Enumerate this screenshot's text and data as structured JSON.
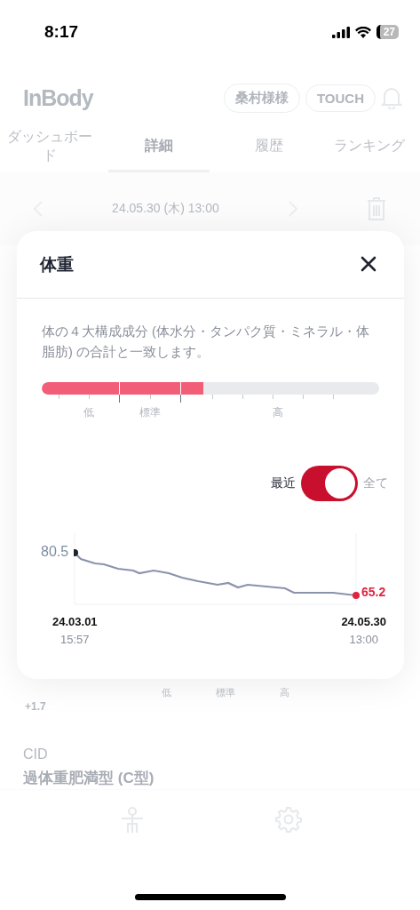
{
  "status_bar": {
    "time": "8:17",
    "battery": "27"
  },
  "header": {
    "logo": "InBody",
    "user_badge": "桑村様様",
    "touch_button": "TOUCH"
  },
  "tabs": [
    {
      "label": "ダッシュボード",
      "selected": false
    },
    {
      "label": "詳細",
      "selected": true
    },
    {
      "label": "履歴",
      "selected": false
    },
    {
      "label": "ランキング",
      "selected": false
    }
  ],
  "date_nav": {
    "date": "24.05.30 (木) 13:00"
  },
  "modal": {
    "title": "体重",
    "description": "体の４大構成成分 (体水分・タンパク質・ミネラル・体脂肪) の合計と一致します。",
    "gauge": {
      "level": 0.48,
      "labels": [
        "低",
        "標準",
        "高"
      ]
    },
    "toggle": {
      "on": true,
      "left_label": "最近",
      "right_label": "全て"
    },
    "trend": {
      "start_value": "80.5",
      "end_value": "65.2",
      "start_date": "24.03.01",
      "start_time": "15:57",
      "end_date": "24.05.30",
      "end_time": "13:00"
    }
  },
  "background": {
    "change": "+1.7",
    "gauge_labels": [
      "低",
      "標準",
      "高"
    ],
    "cid_label": "CID",
    "cid_value": "過体重肥満型 (C型)"
  }
}
